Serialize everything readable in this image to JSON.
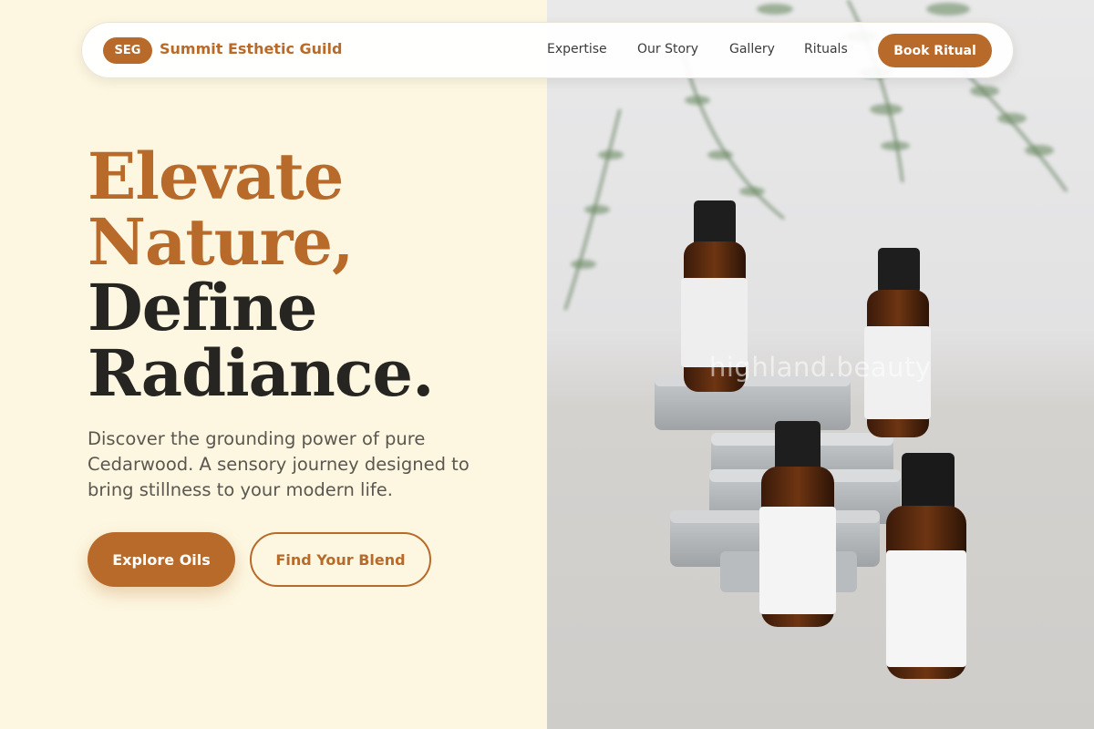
{
  "brand": {
    "badge": "SEG",
    "name": "Summit Esthetic Guild"
  },
  "nav": {
    "links": [
      "Expertise",
      "Our Story",
      "Gallery",
      "Rituals"
    ],
    "cta": "Book Ritual"
  },
  "hero": {
    "title_lines": [
      "Elevate",
      "Nature,",
      "Define",
      "Radiance."
    ],
    "subtitle": "Discover the grounding power of pure Cedarwood. A sensory journey designed to bring stillness to your modern life.",
    "primary_button": "Explore Oils",
    "secondary_button": "Find Your Blend"
  },
  "image": {
    "watermark": "highland.beauty"
  },
  "colors": {
    "accent": "#b86a2a",
    "background": "#fdf7e1",
    "heading_dark": "#262522",
    "body_text": "#5a5750"
  }
}
